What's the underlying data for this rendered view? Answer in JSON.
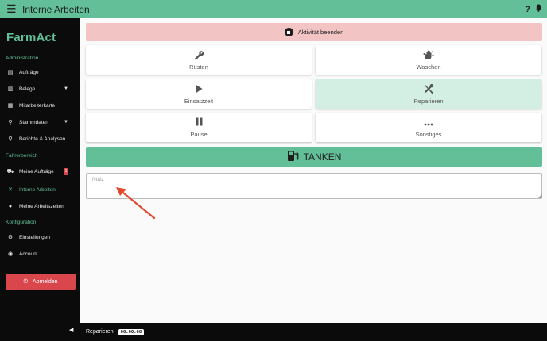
{
  "header": {
    "title": "Interne Arbeiten",
    "help": "?",
    "bell": "bell-icon"
  },
  "sidebar": {
    "logo": "FarmAct",
    "sections": {
      "administration": "Administration",
      "fahrerbereich": "Fahrerbereich",
      "konfiguration": "Konfiguration"
    },
    "items": {
      "auftraege": "Aufträge",
      "belege": "Belege",
      "mitarbeiterkarte": "Mitarbeiterkarte",
      "stammdaten": "Stammdaten",
      "berichte": "Berichte & Analysen",
      "meine_auftraege": "Meine Aufträge",
      "meine_auftraege_badge": "1",
      "interne_arbeiten": "Interne Arbeiten",
      "meine_arbeitszeiten": "Meine Arbeitszeiten",
      "einstellungen": "Einstellungen",
      "account": "Account"
    },
    "logout": "Abmelden"
  },
  "main": {
    "stop_label": "Aktivität beenden",
    "tiles": {
      "ruesten": "Rüsten",
      "waschen": "Waschen",
      "einsatzzeit": "Einsatzzeit",
      "reparieren": "Reparieren",
      "pause": "Pause",
      "sonstiges": "Sonstiges"
    },
    "tanken": "TANKEN",
    "notiz_placeholder": "Notiz"
  },
  "status": {
    "activity": "Reparieren",
    "timer": "00:00:08"
  },
  "colors": {
    "accent": "#62bf98",
    "danger": "#d9474d",
    "stop_bg": "#f2c4c4",
    "selected_bg": "#d3efe4",
    "annotation_arrow": "#e04b2f"
  }
}
